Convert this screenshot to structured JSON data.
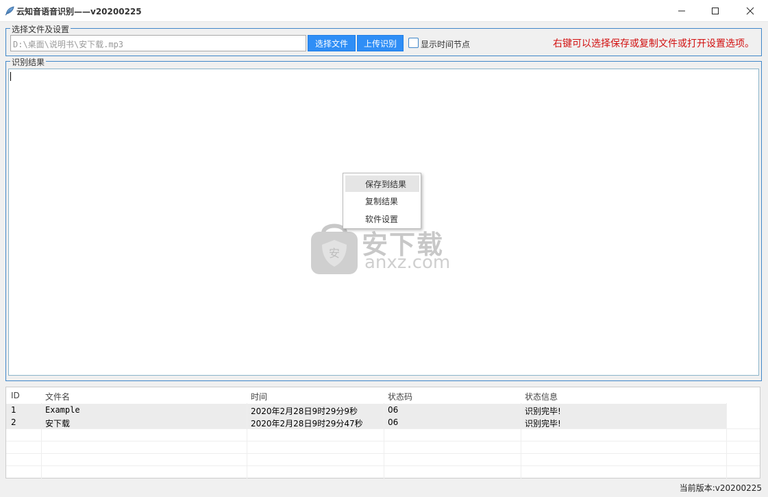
{
  "window": {
    "title": "云知音语音识别——v20200225",
    "icon": "feather-icon"
  },
  "settings": {
    "legend": "选择文件及设置",
    "file_path": "D:\\桌面\\说明书\\安下载.mp3",
    "select_button": "选择文件",
    "upload_button": "上传识别",
    "show_timestamps_label": "显示时间节点",
    "show_timestamps_checked": false,
    "hint": "右键可以选择保存或复制文件或打开设置选项。",
    "hint_color": "#d21010"
  },
  "results": {
    "legend": "识别结果",
    "text": ""
  },
  "context_menu": {
    "items": [
      {
        "label": "保存到结果",
        "hover": true
      },
      {
        "label": "复制结果",
        "hover": false
      },
      {
        "label": "软件设置",
        "hover": false
      }
    ]
  },
  "watermark": {
    "cn": "安下载",
    "en": "anxz.com"
  },
  "table": {
    "columns": [
      "ID",
      "文件名",
      "时间",
      "状态码",
      "状态信息"
    ],
    "rows": [
      [
        "1",
        "Example",
        "2020年2月28日9时29分9秒",
        "06",
        "识别完毕!"
      ],
      [
        "2",
        "安下载",
        "2020年2月28日9时29分47秒",
        "06",
        "识别完毕!"
      ]
    ]
  },
  "status_bar": {
    "version": "当前版本:v20200225"
  },
  "colors": {
    "accent": "#2f8ef6",
    "group_border": "#3f86c9"
  }
}
